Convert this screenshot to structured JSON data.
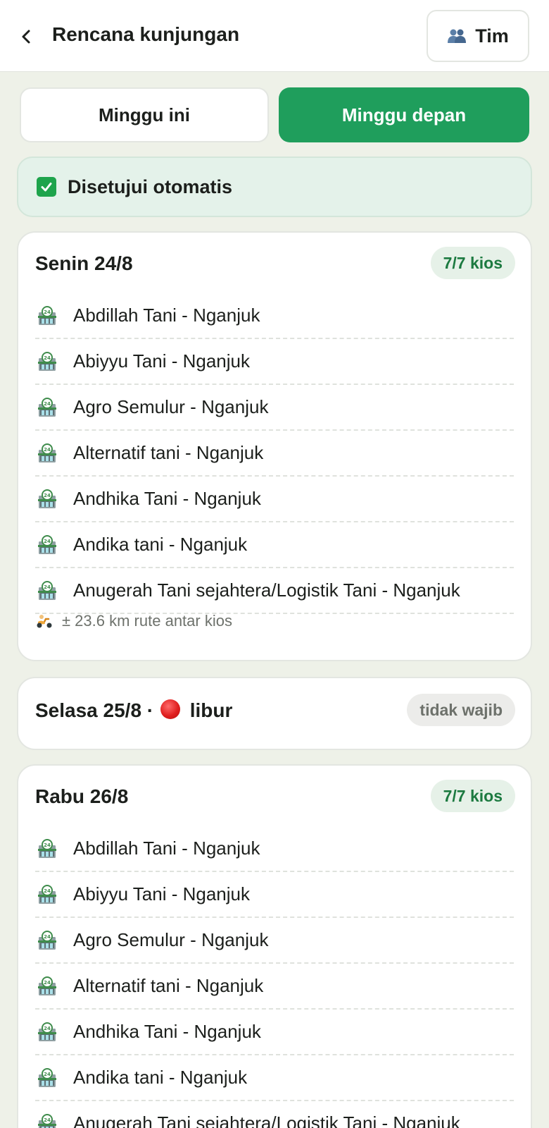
{
  "header": {
    "title": "Rencana kunjungan",
    "team_button": {
      "label": "Tim",
      "icon": "people-icon"
    },
    "back_icon": "chevron-left-icon"
  },
  "tabs": [
    {
      "label": "Minggu ini",
      "active": false
    },
    {
      "label": "Minggu depan",
      "active": true
    }
  ],
  "colors": {
    "accent": "#1f9e5c",
    "approval_bg": "#e4f2ea",
    "pill_green_text": "#1c7a40",
    "holiday_red": "#e01f1f"
  },
  "approval": {
    "icon": "check-square-icon",
    "text": "Disetujui otomatis"
  },
  "days": [
    {
      "title": "Senin 24/8",
      "badge": "7/7 kios",
      "kios": [
        "Abdillah Tani - Nganjuk",
        "Abiyyu Tani - Nganjuk",
        "Agro Semulur - Nganjuk",
        "Alternatif tani - Nganjuk",
        "Andhika Tani - Nganjuk",
        "Andika tani - Nganjuk",
        "Anugerah Tani sejahtera/Logistik Tani - Nganjuk"
      ],
      "route": "± 23.6 km rute antar kios"
    },
    {
      "title": "Selasa 25/8 ·",
      "holiday_label": "libur",
      "badge": "tidak wajib"
    },
    {
      "title": "Rabu 26/8",
      "badge": "7/7 kios",
      "kios": [
        "Abdillah Tani - Nganjuk",
        "Abiyyu Tani - Nganjuk",
        "Agro Semulur - Nganjuk",
        "Alternatif tani - Nganjuk",
        "Andhika Tani - Nganjuk",
        "Andika tani - Nganjuk",
        "Anugerah Tani sejahtera/Logistik Tani - Nganjuk"
      ]
    }
  ]
}
